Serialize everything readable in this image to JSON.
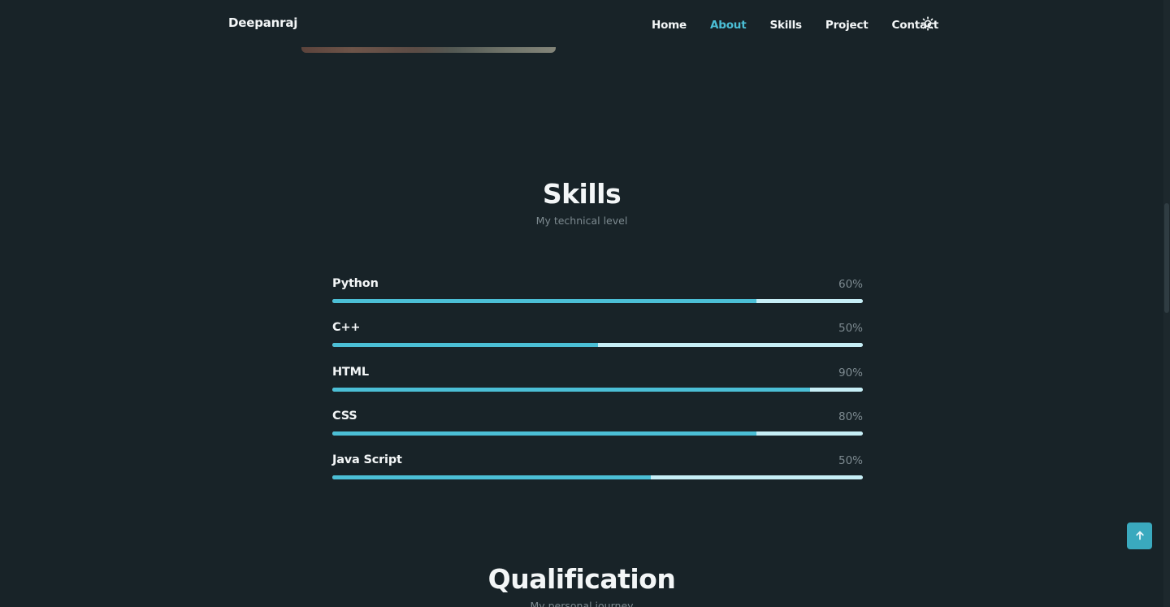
{
  "header": {
    "logo": "Deepanraj",
    "nav": [
      {
        "label": "Home",
        "active": false
      },
      {
        "label": "About",
        "active": true
      },
      {
        "label": "Skills",
        "active": false
      },
      {
        "label": "Project",
        "active": false
      },
      {
        "label": "Contact",
        "active": false
      }
    ],
    "theme_icon": "sun-icon"
  },
  "skills": {
    "title": "Skills",
    "subtitle": "My technical level",
    "items": [
      {
        "name": "Python",
        "percent_label": "60%",
        "fill": 0.8
      },
      {
        "name": "C++",
        "percent_label": "50%",
        "fill": 0.5
      },
      {
        "name": "HTML",
        "percent_label": "90%",
        "fill": 0.9
      },
      {
        "name": "CSS",
        "percent_label": "80%",
        "fill": 0.8
      },
      {
        "name": "Java Script",
        "percent_label": "50%",
        "fill": 0.6
      }
    ]
  },
  "qualification": {
    "title": "Qualification",
    "subtitle": "My personal journey"
  },
  "scroll_up_icon": "arrow-up-icon",
  "colors": {
    "background": "#182328",
    "accent": "#4bbfd6",
    "bar_track": "#c6eef6",
    "text": "#f3f6f7",
    "muted": "#7d8a90"
  }
}
